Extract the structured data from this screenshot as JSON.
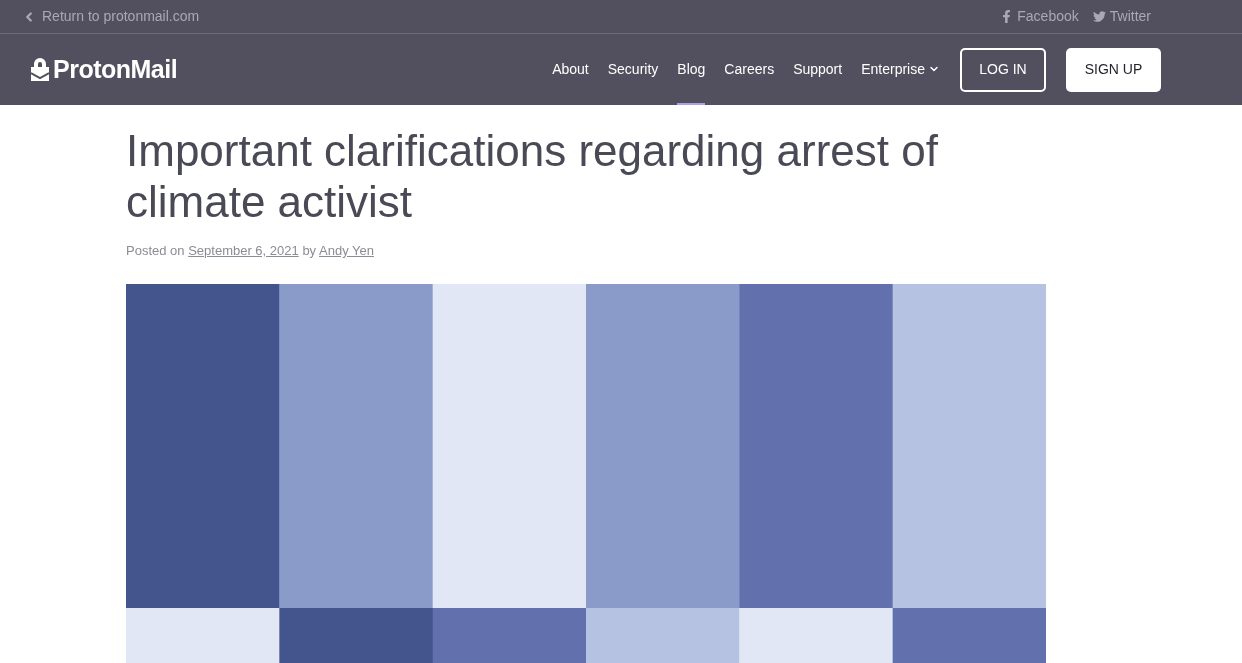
{
  "top_bar": {
    "return_link": "Return to protonmail.com",
    "social_links": [
      {
        "kind": "facebook",
        "label": "Facebook"
      },
      {
        "kind": "twitter",
        "label": "Twitter"
      }
    ]
  },
  "header": {
    "logo": "ProtonMail",
    "nav": [
      {
        "label": "About",
        "selected": false
      },
      {
        "label": "Security",
        "selected": false
      },
      {
        "label": "Blog",
        "selected": true
      },
      {
        "label": "Careers",
        "selected": false
      },
      {
        "label": "Support",
        "selected": false
      },
      {
        "label": "Enterprise",
        "selected": false,
        "kind": "dropdown"
      }
    ],
    "login": "LOG IN",
    "signup": "SIGN UP"
  },
  "article": {
    "title": "Important clarifications regarding arrest of climate activist",
    "byline": {
      "prefix": "Posted on",
      "date": "September 6, 2021",
      "connector": "by",
      "author": "Andy Yen"
    }
  }
}
